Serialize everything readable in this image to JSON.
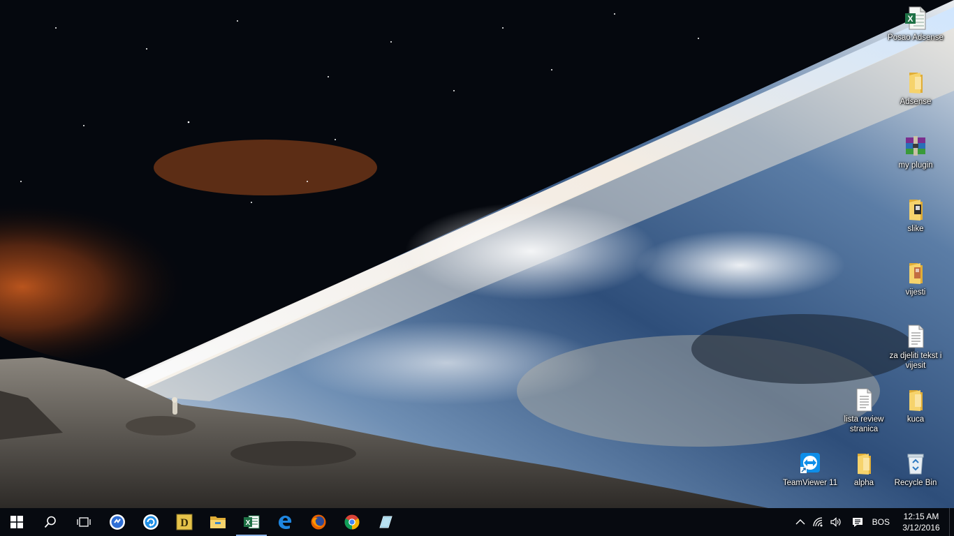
{
  "desktop": {
    "icons": [
      {
        "label": "Posao Adsense",
        "icon": "excel-file-icon"
      },
      {
        "label": "Adsense",
        "icon": "folder-icon"
      },
      {
        "label": "my plugin",
        "icon": "winrar-archive-icon"
      },
      {
        "label": "slike",
        "icon": "folder-icon"
      },
      {
        "label": "vijesti",
        "icon": "folder-icon"
      },
      {
        "label": "za djeliti tekst i vijesit",
        "icon": "text-document-icon"
      },
      {
        "label": "lista review stranica",
        "icon": "text-document-icon"
      },
      {
        "label": "kuca",
        "icon": "folder-icon"
      },
      {
        "label": "TeamViewer 11",
        "icon": "teamviewer-icon"
      },
      {
        "label": "alpha",
        "icon": "folder-icon"
      },
      {
        "label": "Recycle Bin",
        "icon": "recycle-bin-icon"
      }
    ]
  },
  "taskbar": {
    "pinned": [
      {
        "name": "start",
        "icon": "windows-logo-icon"
      },
      {
        "name": "search",
        "icon": "search-icon"
      },
      {
        "name": "task-view",
        "icon": "task-view-icon"
      },
      {
        "name": "app-blue-circle",
        "icon": "blue-circle-app-icon"
      },
      {
        "name": "app-blue-refresh",
        "icon": "blue-refresh-app-icon"
      },
      {
        "name": "app-d",
        "icon": "yellow-d-app-icon"
      },
      {
        "name": "file-explorer",
        "icon": "folder-icon"
      },
      {
        "name": "excel",
        "icon": "excel-icon",
        "active": true
      },
      {
        "name": "edge",
        "icon": "edge-icon"
      },
      {
        "name": "firefox",
        "icon": "firefox-icon"
      },
      {
        "name": "chrome",
        "icon": "chrome-icon"
      },
      {
        "name": "app-glass",
        "icon": "glass-app-icon"
      }
    ],
    "tray": {
      "language": "BOS",
      "time": "12:15 AM",
      "date": "3/12/2016"
    }
  },
  "colors": {
    "taskbar": "#070a10",
    "folder": "#f2c94c",
    "excel": "#1e7145",
    "accent": "#8fb6e8"
  }
}
